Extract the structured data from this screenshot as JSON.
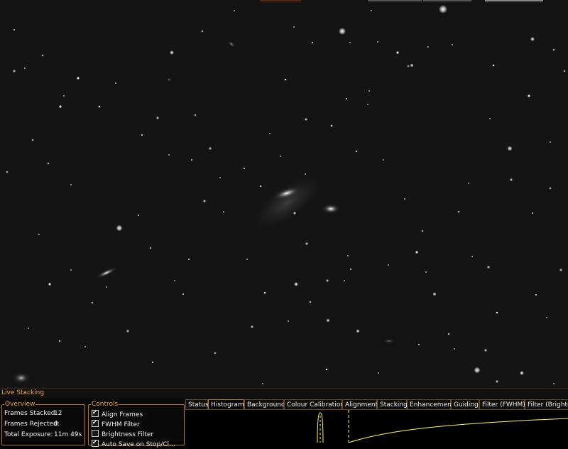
{
  "panel": {
    "title": "Live Stacking"
  },
  "overview": {
    "legend": "Overview",
    "rows": [
      {
        "label": "Frames Stacked:",
        "value": "12"
      },
      {
        "label": "Frames Rejected:",
        "value": "0"
      },
      {
        "label": "Total Exposure:",
        "value": "11m 49s"
      }
    ]
  },
  "controls": {
    "legend": "Controls",
    "items": [
      {
        "label": "Align Frames",
        "checked": true
      },
      {
        "label": "FWHM Filter",
        "checked": true
      },
      {
        "label": "Brightness Filter",
        "checked": false
      },
      {
        "label": "Auto Save on Stop/Cl...",
        "checked": true
      }
    ]
  },
  "tabs": [
    {
      "label": "Status",
      "active": false
    },
    {
      "label": "Histogram",
      "active": true
    },
    {
      "label": "Background",
      "active": false
    },
    {
      "label": "Colour Calibration",
      "active": false
    },
    {
      "label": "Alignment",
      "active": false
    },
    {
      "label": "Stacking",
      "active": false
    },
    {
      "label": "Enhancement",
      "active": false
    },
    {
      "label": "Guiding",
      "active": false
    },
    {
      "label": "Filter (FWHM)",
      "active": false
    },
    {
      "label": "Filter (Brightness)",
      "active": false
    }
  ],
  "colors": {
    "accent": "#e8a33a",
    "border": "#b8761e",
    "histogram_curve": "#ffff33"
  }
}
